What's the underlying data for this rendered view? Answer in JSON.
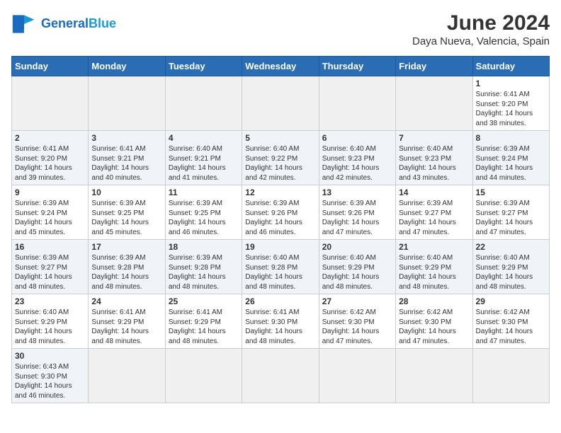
{
  "header": {
    "title": "June 2024",
    "location": "Daya Nueva, Valencia, Spain",
    "logo_general": "General",
    "logo_blue": "Blue"
  },
  "days_of_week": [
    "Sunday",
    "Monday",
    "Tuesday",
    "Wednesday",
    "Thursday",
    "Friday",
    "Saturday"
  ],
  "weeks": [
    [
      {
        "day": "",
        "info": ""
      },
      {
        "day": "",
        "info": ""
      },
      {
        "day": "",
        "info": ""
      },
      {
        "day": "",
        "info": ""
      },
      {
        "day": "",
        "info": ""
      },
      {
        "day": "",
        "info": ""
      },
      {
        "day": "1",
        "info": "Sunrise: 6:41 AM\nSunset: 9:20 PM\nDaylight: 14 hours\nand 38 minutes."
      }
    ],
    [
      {
        "day": "2",
        "info": "Sunrise: 6:41 AM\nSunset: 9:20 PM\nDaylight: 14 hours\nand 39 minutes."
      },
      {
        "day": "3",
        "info": "Sunrise: 6:41 AM\nSunset: 9:21 PM\nDaylight: 14 hours\nand 40 minutes."
      },
      {
        "day": "4",
        "info": "Sunrise: 6:40 AM\nSunset: 9:21 PM\nDaylight: 14 hours\nand 41 minutes."
      },
      {
        "day": "5",
        "info": "Sunrise: 6:40 AM\nSunset: 9:22 PM\nDaylight: 14 hours\nand 42 minutes."
      },
      {
        "day": "6",
        "info": "Sunrise: 6:40 AM\nSunset: 9:23 PM\nDaylight: 14 hours\nand 42 minutes."
      },
      {
        "day": "7",
        "info": "Sunrise: 6:40 AM\nSunset: 9:23 PM\nDaylight: 14 hours\nand 43 minutes."
      },
      {
        "day": "8",
        "info": "Sunrise: 6:39 AM\nSunset: 9:24 PM\nDaylight: 14 hours\nand 44 minutes."
      }
    ],
    [
      {
        "day": "9",
        "info": "Sunrise: 6:39 AM\nSunset: 9:24 PM\nDaylight: 14 hours\nand 45 minutes."
      },
      {
        "day": "10",
        "info": "Sunrise: 6:39 AM\nSunset: 9:25 PM\nDaylight: 14 hours\nand 45 minutes."
      },
      {
        "day": "11",
        "info": "Sunrise: 6:39 AM\nSunset: 9:25 PM\nDaylight: 14 hours\nand 46 minutes."
      },
      {
        "day": "12",
        "info": "Sunrise: 6:39 AM\nSunset: 9:26 PM\nDaylight: 14 hours\nand 46 minutes."
      },
      {
        "day": "13",
        "info": "Sunrise: 6:39 AM\nSunset: 9:26 PM\nDaylight: 14 hours\nand 47 minutes."
      },
      {
        "day": "14",
        "info": "Sunrise: 6:39 AM\nSunset: 9:27 PM\nDaylight: 14 hours\nand 47 minutes."
      },
      {
        "day": "15",
        "info": "Sunrise: 6:39 AM\nSunset: 9:27 PM\nDaylight: 14 hours\nand 47 minutes."
      }
    ],
    [
      {
        "day": "16",
        "info": "Sunrise: 6:39 AM\nSunset: 9:27 PM\nDaylight: 14 hours\nand 48 minutes."
      },
      {
        "day": "17",
        "info": "Sunrise: 6:39 AM\nSunset: 9:28 PM\nDaylight: 14 hours\nand 48 minutes."
      },
      {
        "day": "18",
        "info": "Sunrise: 6:39 AM\nSunset: 9:28 PM\nDaylight: 14 hours\nand 48 minutes."
      },
      {
        "day": "19",
        "info": "Sunrise: 6:40 AM\nSunset: 9:28 PM\nDaylight: 14 hours\nand 48 minutes."
      },
      {
        "day": "20",
        "info": "Sunrise: 6:40 AM\nSunset: 9:29 PM\nDaylight: 14 hours\nand 48 minutes."
      },
      {
        "day": "21",
        "info": "Sunrise: 6:40 AM\nSunset: 9:29 PM\nDaylight: 14 hours\nand 48 minutes."
      },
      {
        "day": "22",
        "info": "Sunrise: 6:40 AM\nSunset: 9:29 PM\nDaylight: 14 hours\nand 48 minutes."
      }
    ],
    [
      {
        "day": "23",
        "info": "Sunrise: 6:40 AM\nSunset: 9:29 PM\nDaylight: 14 hours\nand 48 minutes."
      },
      {
        "day": "24",
        "info": "Sunrise: 6:41 AM\nSunset: 9:29 PM\nDaylight: 14 hours\nand 48 minutes."
      },
      {
        "day": "25",
        "info": "Sunrise: 6:41 AM\nSunset: 9:29 PM\nDaylight: 14 hours\nand 48 minutes."
      },
      {
        "day": "26",
        "info": "Sunrise: 6:41 AM\nSunset: 9:30 PM\nDaylight: 14 hours\nand 48 minutes."
      },
      {
        "day": "27",
        "info": "Sunrise: 6:42 AM\nSunset: 9:30 PM\nDaylight: 14 hours\nand 47 minutes."
      },
      {
        "day": "28",
        "info": "Sunrise: 6:42 AM\nSunset: 9:30 PM\nDaylight: 14 hours\nand 47 minutes."
      },
      {
        "day": "29",
        "info": "Sunrise: 6:42 AM\nSunset: 9:30 PM\nDaylight: 14 hours\nand 47 minutes."
      }
    ],
    [
      {
        "day": "30",
        "info": "Sunrise: 6:43 AM\nSunset: 9:30 PM\nDaylight: 14 hours\nand 46 minutes."
      },
      {
        "day": "",
        "info": ""
      },
      {
        "day": "",
        "info": ""
      },
      {
        "day": "",
        "info": ""
      },
      {
        "day": "",
        "info": ""
      },
      {
        "day": "",
        "info": ""
      },
      {
        "day": "",
        "info": ""
      }
    ]
  ]
}
